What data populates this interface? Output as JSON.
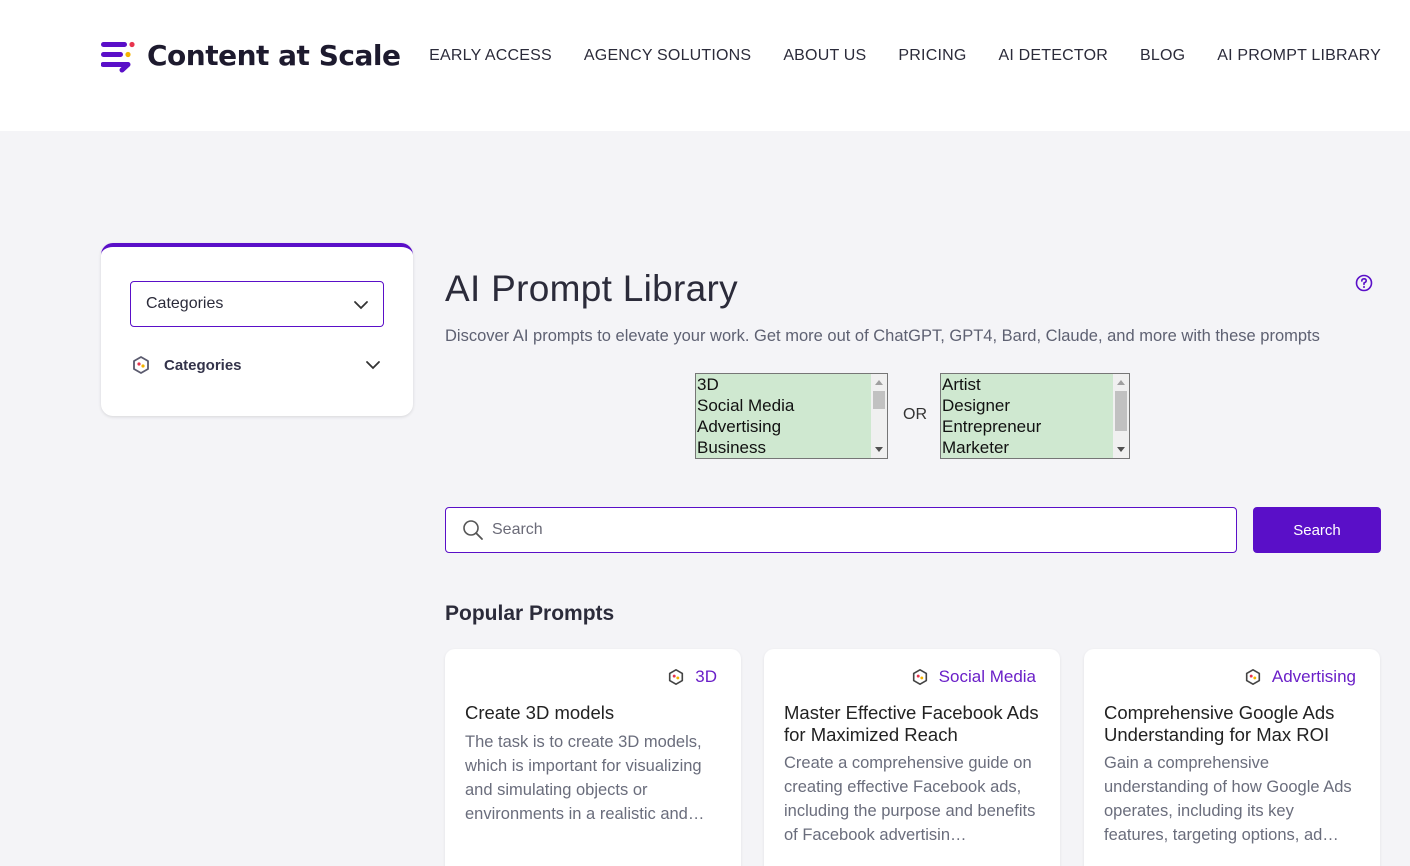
{
  "brand": {
    "name": "Content at Scale",
    "accent": "#5a0fc8"
  },
  "nav": [
    "EARLY ACCESS",
    "AGENCY SOLUTIONS",
    "ABOUT US",
    "PRICING",
    "AI DETECTOR",
    "BLOG",
    "AI PROMPT LIBRARY"
  ],
  "sidebar": {
    "select_value": "Categories",
    "section_label": "Categories",
    "icons": {
      "select": "chevron-down-icon",
      "section": "hexagon-category-icon"
    }
  },
  "main": {
    "title": "AI Prompt Library",
    "subtitle": "Discover AI prompts to elevate your work. Get more out of ChatGPT, GPT4, Bard, Claude, and more with these prompts",
    "help_icon": "question-circle-icon",
    "category_list": [
      "3D",
      "Social Media",
      "Advertising",
      "Business"
    ],
    "or_label": "OR",
    "role_list": [
      "Artist",
      "Designer",
      "Entrepreneur",
      "Marketer"
    ],
    "search": {
      "placeholder": "Search",
      "button": "Search"
    },
    "popular_heading": "Popular Prompts",
    "cards": [
      {
        "tag": "3D",
        "title": "Create 3D models",
        "description": "The task is to create 3D models, which is important for visualizing and simulating objects or environments in a realistic and…"
      },
      {
        "tag": "Social Media",
        "title": "Master Effective Facebook Ads for Maximized Reach",
        "description": "Create a comprehensive guide on creating effective Facebook ads, including the purpose and benefits of Facebook advertisin…"
      },
      {
        "tag": "Advertising",
        "title": "Comprehensive Google Ads Understanding for Max ROI",
        "description": "Gain a comprehensive understanding of how Google Ads operates, including its key features, targeting options, ad…"
      }
    ]
  }
}
